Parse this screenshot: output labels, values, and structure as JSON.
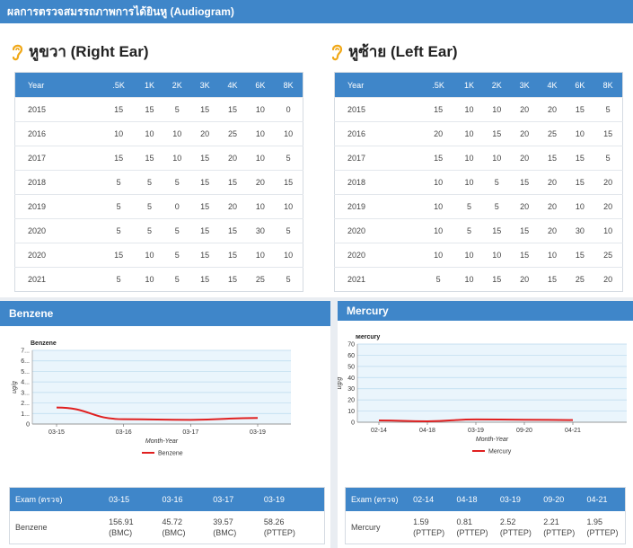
{
  "header": {
    "title": "ผลการตรวจสมรรถภาพการได้ยินหู (Audiogram)"
  },
  "columns": [
    "Year",
    ".5K",
    "1K",
    "2K",
    "3K",
    "4K",
    "6K",
    "8K"
  ],
  "right_ear": {
    "title": "หูขวา (Right Ear)",
    "rows": [
      [
        "2015",
        "15",
        "15",
        "5",
        "15",
        "15",
        "10",
        "0"
      ],
      [
        "2016",
        "10",
        "10",
        "10",
        "20",
        "25",
        "10",
        "10"
      ],
      [
        "2017",
        "15",
        "15",
        "10",
        "15",
        "20",
        "10",
        "5"
      ],
      [
        "2018",
        "5",
        "5",
        "5",
        "15",
        "15",
        "20",
        "15"
      ],
      [
        "2019",
        "5",
        "5",
        "0",
        "15",
        "20",
        "10",
        "10"
      ],
      [
        "2020",
        "5",
        "5",
        "5",
        "15",
        "15",
        "30",
        "5"
      ],
      [
        "2020",
        "15",
        "10",
        "5",
        "15",
        "15",
        "10",
        "10"
      ],
      [
        "2021",
        "5",
        "10",
        "5",
        "15",
        "15",
        "25",
        "5"
      ]
    ]
  },
  "left_ear": {
    "title": "หูซ้าย (Left Ear)",
    "rows": [
      [
        "2015",
        "15",
        "10",
        "10",
        "20",
        "20",
        "15",
        "5"
      ],
      [
        "2016",
        "20",
        "10",
        "15",
        "20",
        "25",
        "10",
        "15"
      ],
      [
        "2017",
        "15",
        "10",
        "10",
        "20",
        "15",
        "15",
        "5"
      ],
      [
        "2018",
        "10",
        "10",
        "5",
        "15",
        "20",
        "15",
        "20"
      ],
      [
        "2019",
        "10",
        "5",
        "5",
        "20",
        "20",
        "10",
        "20"
      ],
      [
        "2020",
        "10",
        "5",
        "15",
        "15",
        "20",
        "30",
        "10"
      ],
      [
        "2020",
        "10",
        "10",
        "10",
        "15",
        "10",
        "15",
        "25"
      ],
      [
        "2021",
        "5",
        "10",
        "15",
        "20",
        "15",
        "25",
        "20"
      ]
    ]
  },
  "benzene": {
    "card_title": "Benzene",
    "exam_header": [
      "Exam (ตรวจ)",
      "03-15",
      "03-16",
      "03-17",
      "03-19"
    ],
    "exam_row": [
      "Benzene",
      "156.91\n(BMC)",
      "45.72\n(BMC)",
      "39.57\n(BMC)",
      "58.26\n(PTTEP)"
    ]
  },
  "mercury": {
    "card_title": "Mercury",
    "exam_header": [
      "Exam (ตรวจ)",
      "02-14",
      "04-18",
      "03-19",
      "09-20",
      "04-21"
    ],
    "exam_row": [
      "Mercury",
      "1.59\n(PTTEP)",
      "0.81\n(PTTEP)",
      "2.52\n(PTTEP)",
      "2.21\n(PTTEP)",
      "1.95\n(PTTEP)"
    ]
  },
  "chart_data": [
    {
      "type": "line",
      "title": "Benzene",
      "xlabel": "Month-Year",
      "ylabel": "ug/g",
      "categories": [
        "03-15",
        "03-16",
        "03-17",
        "03-19"
      ],
      "yticks": [
        "0",
        "1...",
        "2...",
        "3...",
        "4...",
        "5...",
        "6...",
        "7..."
      ],
      "ylim": [
        0,
        7
      ],
      "series": [
        {
          "name": "Benzene",
          "values": [
            1.57,
            0.46,
            0.4,
            0.58
          ],
          "color": "#e02020"
        }
      ],
      "legend": "bottom-center",
      "grid": true
    },
    {
      "type": "line",
      "title": "Mercury",
      "xlabel": "Month-Year",
      "ylabel": "ug/g",
      "categories": [
        "02-14",
        "04-18",
        "03-19",
        "09-20",
        "04-21"
      ],
      "yticks": [
        "0",
        "10",
        "20",
        "30",
        "40",
        "50",
        "60",
        "70"
      ],
      "ylim": [
        0,
        70
      ],
      "series": [
        {
          "name": "Mercury",
          "values": [
            1.59,
            0.81,
            2.52,
            2.21,
            1.95
          ],
          "color": "#e02020"
        }
      ],
      "legend": "bottom-center",
      "grid": true
    }
  ]
}
